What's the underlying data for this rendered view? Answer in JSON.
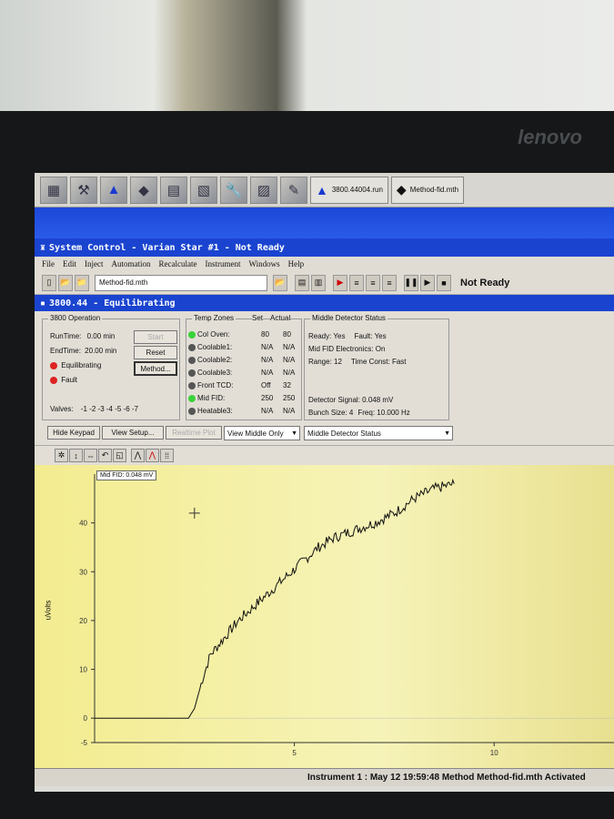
{
  "monitor": {
    "brand": "lenovo"
  },
  "taskbar": {
    "run_label": "3800.44004.run",
    "method_label": "Method-fid.mth"
  },
  "window": {
    "title": "System Control - Varian Star #1 - Not Ready"
  },
  "menu": [
    "File",
    "Edit",
    "Inject",
    "Automation",
    "Recalculate",
    "Instrument",
    "Windows",
    "Help"
  ],
  "toolbar": {
    "method_file": "Method-fid.mth",
    "status": "Not Ready"
  },
  "subwindow": {
    "title": "3800.44 - Equilibrating"
  },
  "operation": {
    "legend": "3800 Operation",
    "runtime_label": "RunTime:",
    "runtime": "0.00 min",
    "endtime_label": "EndTime:",
    "endtime": "20.00 min",
    "equilibrating": "Equilibrating",
    "fault": "Fault",
    "valves_label": "Valves:",
    "valves": "-1 -2 -3 -4 -5 -6 -7",
    "start": "Start",
    "reset": "Reset",
    "method": "Method..."
  },
  "temps": {
    "legend": "Temp Zones",
    "set": "Set",
    "actual": "Actual",
    "zones": [
      {
        "name": "Col Oven:",
        "set": "80",
        "actual": "80",
        "led": "#3ad23a"
      },
      {
        "name": "Coolable1:",
        "set": "N/A",
        "actual": "N/A",
        "led": "#555"
      },
      {
        "name": "Coolable2:",
        "set": "N/A",
        "actual": "N/A",
        "led": "#555"
      },
      {
        "name": "Coolable3:",
        "set": "N/A",
        "actual": "N/A",
        "led": "#555"
      },
      {
        "name": "Front TCD:",
        "set": "Off",
        "actual": "32",
        "led": "#555"
      },
      {
        "name": "Mid FID:",
        "set": "250",
        "actual": "250",
        "led": "#3ad23a"
      },
      {
        "name": "Heatable3:",
        "set": "N/A",
        "actual": "N/A",
        "led": "#555"
      }
    ]
  },
  "detector": {
    "legend": "Middle Detector Status",
    "ready": "Ready: Yes",
    "fault": "Fault: Yes",
    "electronics": "Mid FID Electronics: On",
    "range": "Range: 12",
    "timeconst": "Time Const: Fast",
    "signal": "Detector Signal: 0.048 mV",
    "bunch": "Bunch Size: 4",
    "freq": "Freq: 10.000 Hz"
  },
  "buttons": {
    "hide_keypad": "Hide Keypad",
    "view_setup": "View Setup...",
    "realtime": "Realtime Plot",
    "view_select": "View Middle Only",
    "status_select": "Middle Detector Status"
  },
  "chart_data": {
    "type": "line",
    "ylabel": "uVolts",
    "xlabel": "",
    "tooltip": "Mid FID: 0.048 mV",
    "xlim": [
      0,
      13
    ],
    "ylim": [
      -5,
      50
    ],
    "xticks": [
      5,
      10
    ],
    "yticks": [
      -5,
      0,
      10,
      20,
      30,
      40
    ],
    "x": [
      0,
      2.35,
      2.5,
      2.7,
      2.9,
      3.2,
      3.6,
      4.0,
      4.4,
      4.8,
      5.2,
      5.6,
      6.0,
      6.5,
      7.0,
      7.5,
      8.0,
      8.5,
      9.0
    ],
    "y": [
      0,
      0,
      2,
      8,
      13,
      16,
      20,
      23,
      26,
      29,
      32,
      35,
      37,
      38.5,
      40,
      42,
      45,
      47,
      48
    ]
  },
  "statusbar": {
    "text": "Instrument 1 : May 12 19:59:48  Method Method-fid.mth Activated"
  }
}
